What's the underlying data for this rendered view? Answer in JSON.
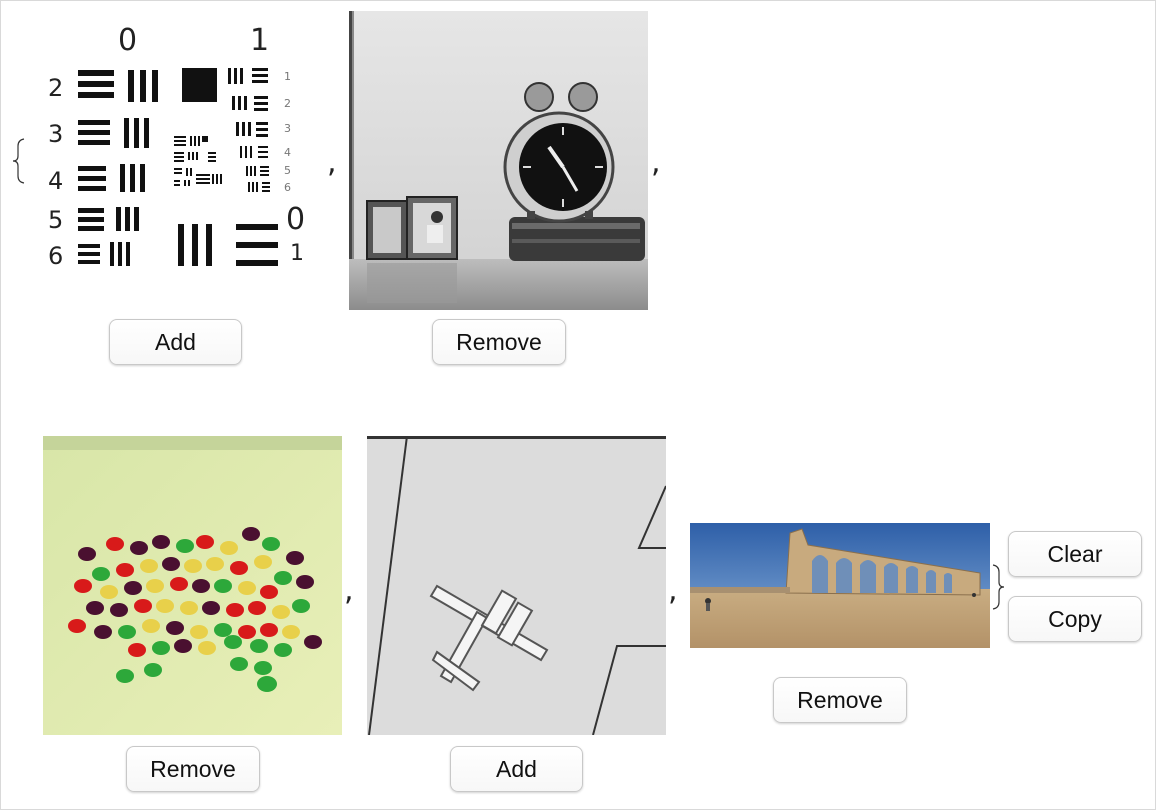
{
  "row1": {
    "images": [
      {
        "name": "resolution-chart-image",
        "button": "Add",
        "labels": {
          "g0": "0",
          "g1": "1",
          "r2": "2",
          "r3": "3",
          "r4": "4",
          "r5": "5",
          "r6": "6",
          "s1": "1",
          "s2": "2",
          "s3": "3",
          "s4": "4",
          "s5": "5",
          "s6": "6",
          "t0": "0",
          "t1": "1"
        }
      },
      {
        "name": "alarm-clock-image",
        "button": "Remove"
      }
    ],
    "sep1": ",",
    "sep2": ","
  },
  "row2": {
    "images": [
      {
        "name": "jellybeans-image",
        "button": "Remove"
      },
      {
        "name": "airplane-image",
        "button": "Add"
      },
      {
        "name": "ruins-panorama-image",
        "button": "Remove"
      }
    ],
    "sep1": ",",
    "sep2": ","
  },
  "actions": {
    "clear": "Clear",
    "copy": "Copy"
  },
  "colors": {
    "button_border": "#c8c8c8",
    "background": "#ffffff"
  }
}
